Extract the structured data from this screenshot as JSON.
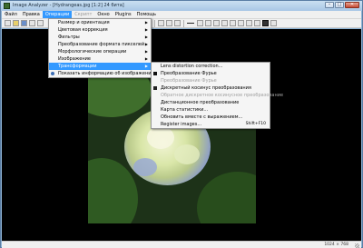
{
  "window": {
    "title": "Image Analyzer - [Hydrangeas.jpg [1:2] 24 бита]",
    "min_glyph": "–",
    "max_glyph": "□",
    "close_glyph": "✕"
  },
  "menubar": {
    "items": [
      {
        "label": "Файл"
      },
      {
        "label": "Правка"
      },
      {
        "label": "Операции"
      },
      {
        "label": "Скрипт"
      },
      {
        "label": "Окно"
      },
      {
        "label": "Plugins"
      },
      {
        "label": "Помощь"
      }
    ]
  },
  "operations_menu": {
    "items": [
      {
        "label": "Размер и ориентация",
        "arrow": "▶"
      },
      {
        "label": "Цветовая коррекция",
        "arrow": "▶"
      },
      {
        "label": "Фильтры",
        "arrow": "▶"
      },
      {
        "label": "Преобразование формата пикселей",
        "arrow": "▶"
      },
      {
        "label": "Морфологические операции",
        "arrow": "▶"
      },
      {
        "label": "Изображение",
        "arrow": "▶"
      },
      {
        "label": "Трансформации",
        "arrow": "▶"
      },
      {
        "label": "Показать информацию об изображении"
      }
    ]
  },
  "transform_menu": {
    "items": [
      {
        "label": "Lens distortion correction..."
      },
      {
        "label": "Преобразование Фурье"
      },
      {
        "label": "Преобразование Фурье"
      },
      {
        "label": "Дискретный косинус преобразования"
      },
      {
        "label": "Обратное дискретное косинусное преобразование"
      },
      {
        "label": "Дистанционное преобразование"
      },
      {
        "label": "Карта статистики..."
      },
      {
        "label": "Обновить вместе с выражением..."
      },
      {
        "label": "Register images...",
        "shortcut": "Shift+F10"
      }
    ]
  },
  "statusbar": {
    "dimensions": "1024 × 768"
  }
}
